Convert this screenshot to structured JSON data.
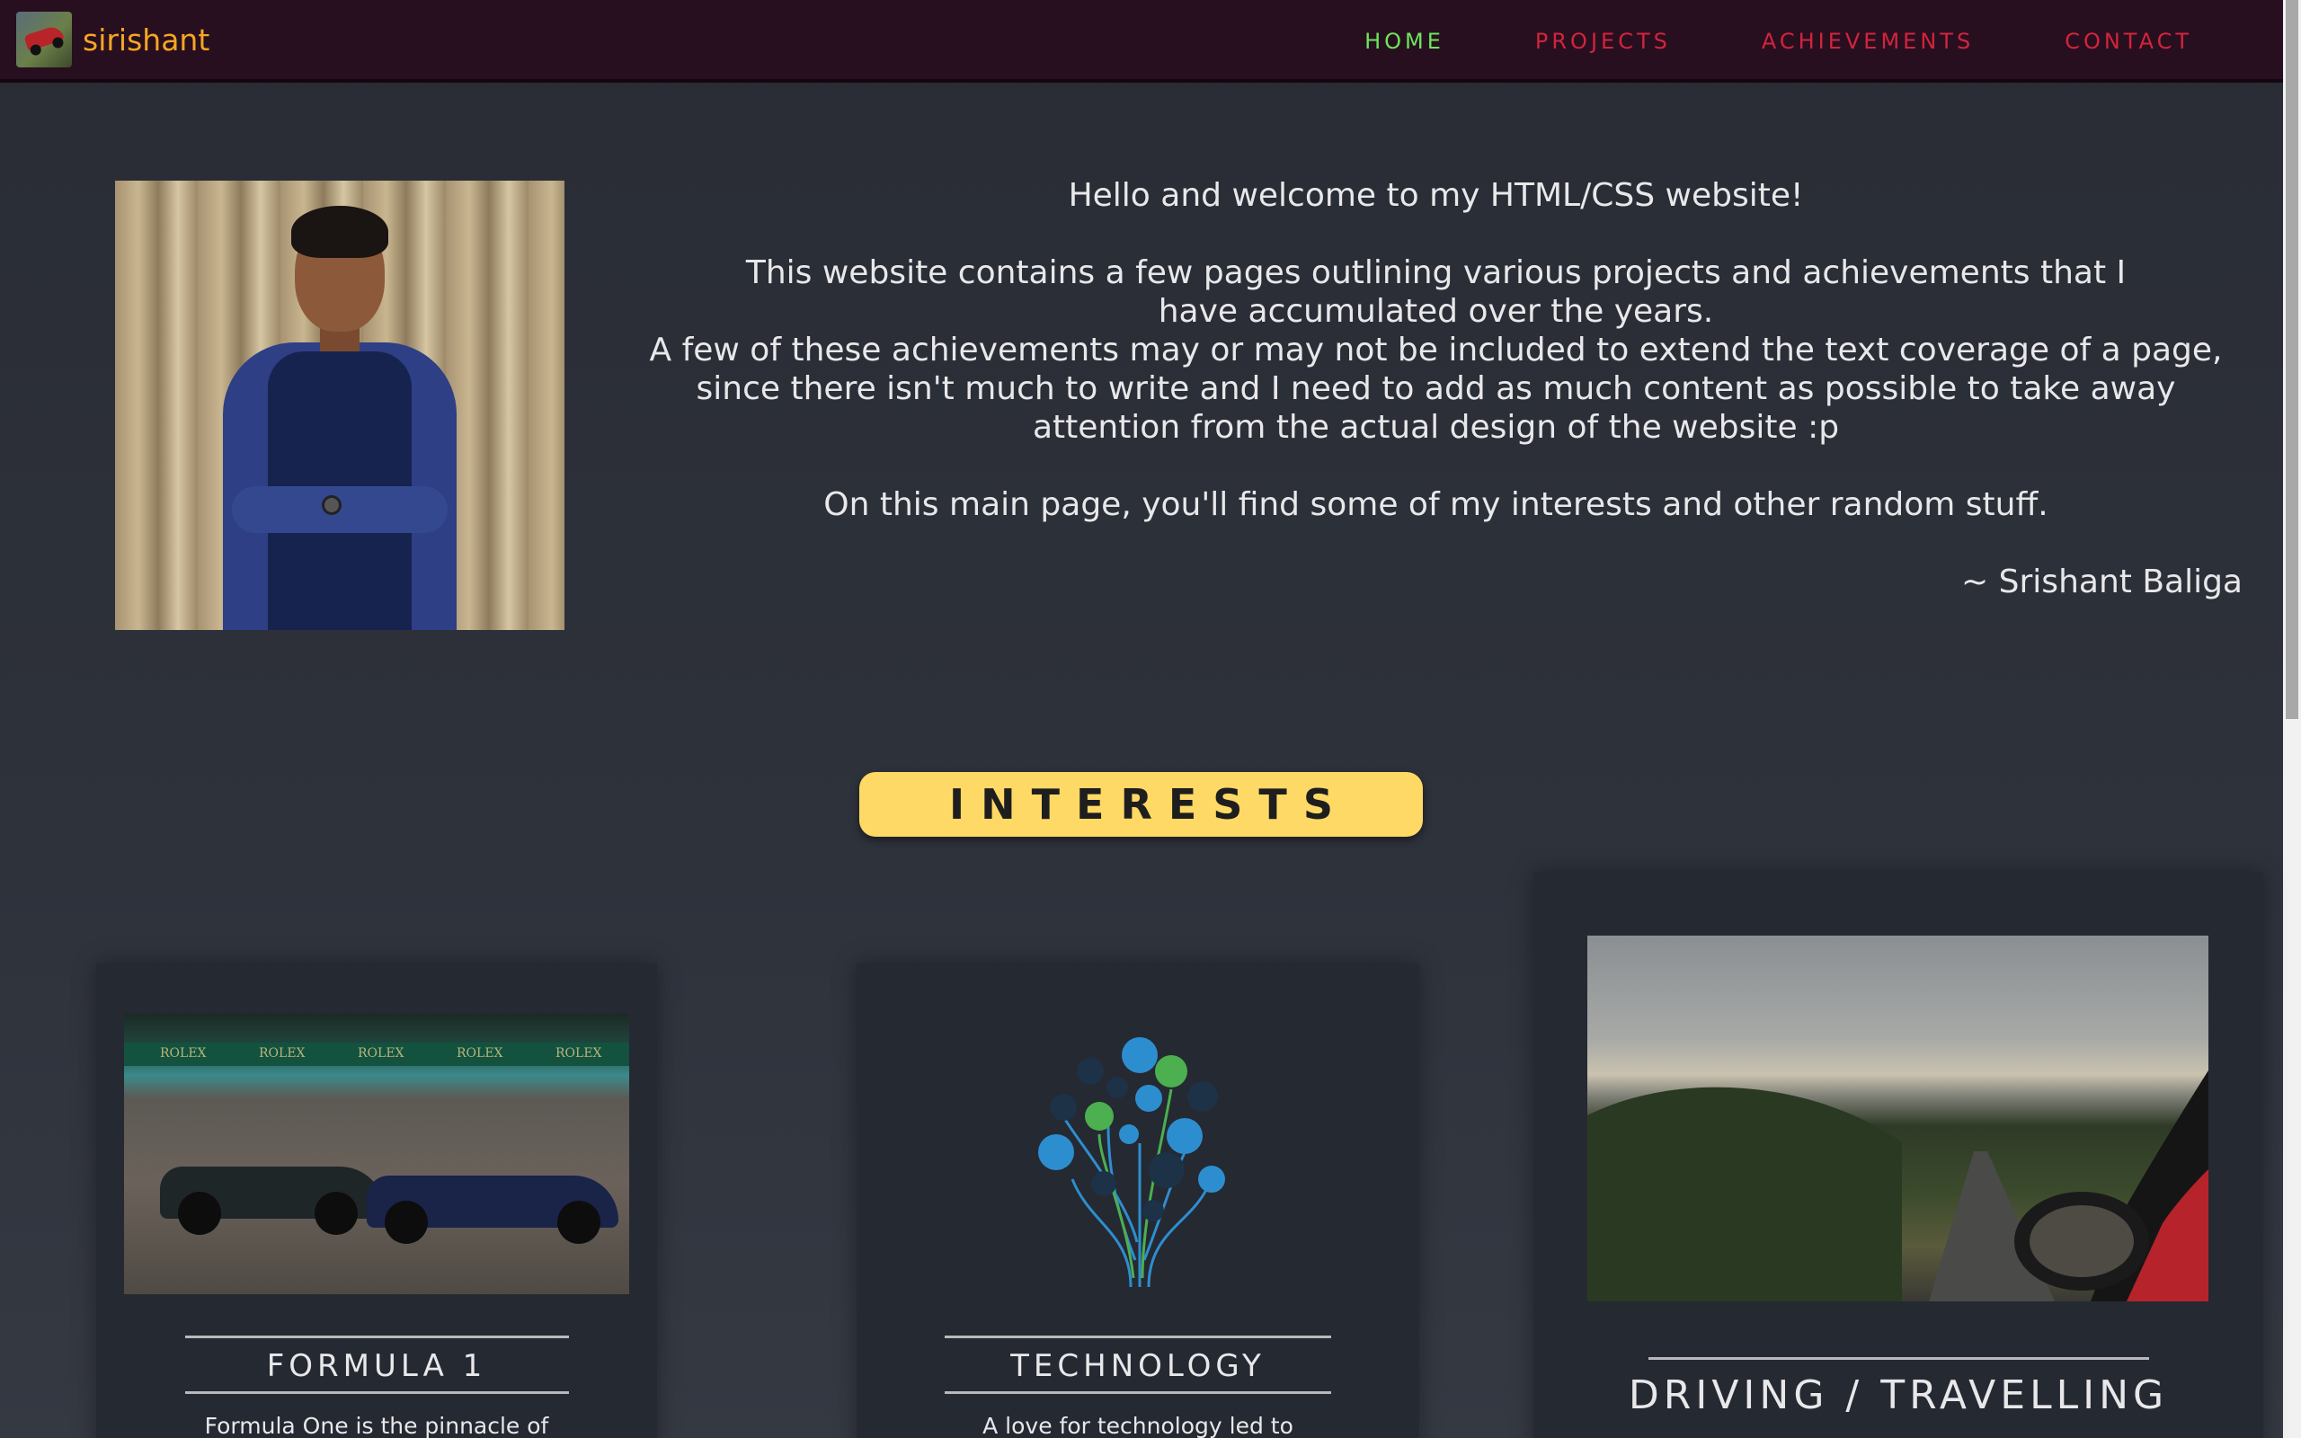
{
  "brand": {
    "name": "sirishant"
  },
  "nav": {
    "items": [
      {
        "label": "HOME",
        "active": true
      },
      {
        "label": "PROJECTS",
        "active": false
      },
      {
        "label": "ACHIEVEMENTS",
        "active": false
      },
      {
        "label": "CONTACT",
        "active": false
      }
    ]
  },
  "intro": {
    "welcome": "Hello and welcome to my HTML/CSS website!",
    "para1": "This website contains a few pages outlining various projects and achievements that I have accumulated over the years.",
    "para2": "A few of these achievements may or may not be included to extend the text coverage of a page, since there isn't much to write and I need to add as much content as possible to take away attention from the actual design of the website :p",
    "para3": "On this main page, you'll find some of my interests and other random stuff.",
    "signature": "~ Srishant Baliga"
  },
  "interests": {
    "heading": "INTERESTS",
    "cards": [
      {
        "title": "FORMULA 1",
        "desc": "Formula One is the pinnacle of"
      },
      {
        "title": "TECHNOLOGY",
        "desc": "A love for technology led to"
      },
      {
        "title": "DRIVING / TRAVELLING",
        "desc": ""
      }
    ]
  },
  "colors": {
    "navbar_bg": "#280f1f",
    "brand": "#f5a623",
    "nav_link": "#d2243c",
    "nav_active": "#6ce65a",
    "badge": "#ffd966",
    "card_bg": "#252932"
  }
}
